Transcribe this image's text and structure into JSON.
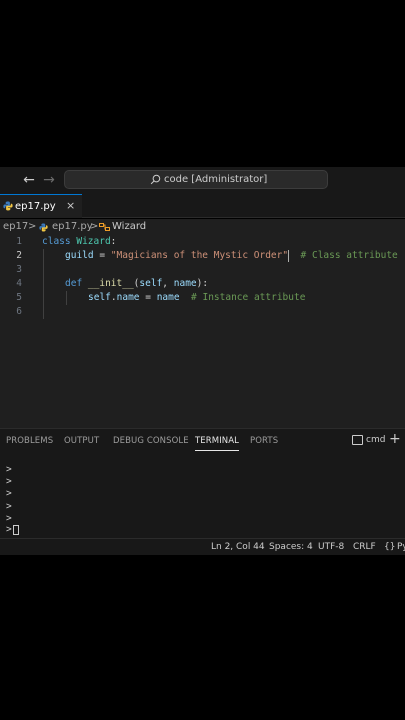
{
  "titlebar": {
    "command_center": "code [Administrator]"
  },
  "tab": {
    "label": "ep17.py",
    "close": "×"
  },
  "breadcrumbs": {
    "folder": "ep17",
    "file": "ep17.py",
    "symbol": "Wizard",
    "separator": ">"
  },
  "editor": {
    "active_line": 2,
    "lines": [
      {
        "number": "1",
        "tokens": [
          [
            "kw",
            "class"
          ],
          [
            "op",
            " "
          ],
          [
            "cls",
            "Wizard"
          ],
          [
            "op",
            ":"
          ]
        ]
      },
      {
        "number": "2",
        "tokens": [
          [
            "var",
            "guild"
          ],
          [
            "op",
            " = "
          ],
          [
            "str",
            "\"Magicians of the Mystic Order\""
          ],
          [
            "cursor",
            ""
          ],
          [
            "op",
            "  "
          ],
          [
            "cmt",
            "# Class attribute"
          ]
        ]
      },
      {
        "number": "3",
        "tokens": []
      },
      {
        "number": "4",
        "tokens": [
          [
            "kw",
            "def"
          ],
          [
            "op",
            " "
          ],
          [
            "fn",
            "__init__"
          ],
          [
            "op",
            "("
          ],
          [
            "var",
            "self"
          ],
          [
            "op",
            ", "
          ],
          [
            "var",
            "name"
          ],
          [
            "op",
            "):"
          ]
        ]
      },
      {
        "number": "5",
        "tokens": [
          [
            "var",
            "self"
          ],
          [
            "op",
            "."
          ],
          [
            "var",
            "name"
          ],
          [
            "op",
            " = "
          ],
          [
            "var",
            "name"
          ],
          [
            "op",
            "  "
          ],
          [
            "cmt",
            "# Instance attribute"
          ]
        ]
      },
      {
        "number": "6",
        "tokens": []
      }
    ]
  },
  "panel": {
    "tabs": [
      "PROBLEMS",
      "OUTPUT",
      "DEBUG CONSOLE",
      "TERMINAL",
      "PORTS"
    ],
    "active_tab": "TERMINAL",
    "terminal_kind": "cmd",
    "add": "+"
  },
  "terminal": {
    "lines": [
      ">",
      ">",
      ">",
      ">",
      ">",
      ">"
    ]
  },
  "statusbar": {
    "position": "Ln 2, Col 44",
    "spaces": "Spaces: 4",
    "encoding": "UTF-8",
    "eol": "CRLF",
    "language": "Py"
  },
  "colors": {
    "accent": "#0078d4",
    "editor_bg": "#1f1f1f",
    "chrome_bg": "#181818"
  }
}
